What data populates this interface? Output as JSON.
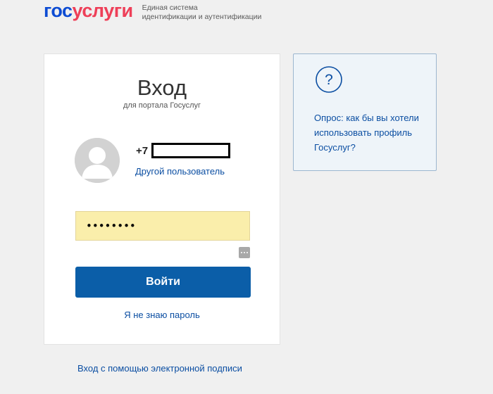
{
  "brand": {
    "logo_part1": "гос",
    "logo_part2": "услуги",
    "tagline_line1": "Единая система",
    "tagline_line2": "идентификации и аутентификации",
    "colors": {
      "gos": "#0d4cd3",
      "uslugi": "#ee3f58"
    }
  },
  "login": {
    "title": "Вход",
    "subtitle": "для портала Госуслуг",
    "phone_prefix": "+7",
    "other_user_link": "Другой пользователь",
    "password_value": "••••••••",
    "submit_label": "Войти",
    "forgot_link": "Я не знаю пароль",
    "icons": {
      "avatar": "user-avatar-icon",
      "password_toggle": "show-password-icon"
    },
    "colors": {
      "button": "#0b5ea8",
      "password_bg": "#faeeab",
      "link": "#0b4ea2"
    }
  },
  "survey": {
    "icon": "question-mark-icon",
    "text": "Опрос: как бы вы хотели использовать профиль Госуслуг?"
  },
  "footer": {
    "esign_link": "Вход с помощью электронной подписи"
  }
}
